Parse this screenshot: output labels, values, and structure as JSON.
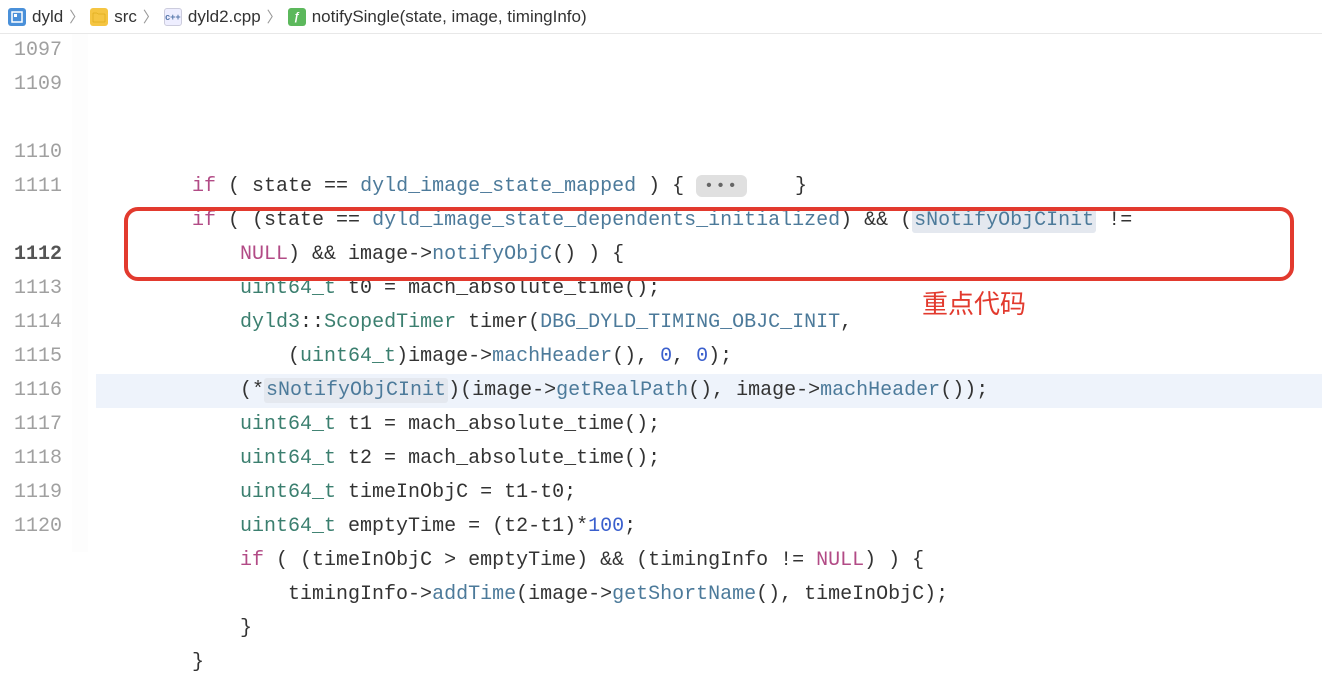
{
  "breadcrumb": {
    "project": "dyld",
    "folder": "src",
    "file": "dyld2.cpp",
    "func": "notifySingle(state, image, timingInfo)"
  },
  "annotation": "重点代码",
  "fold_marker": "•••",
  "lines": [
    {
      "no": "1097",
      "tokens": [
        {
          "t": "        ",
          "c": "op"
        },
        {
          "t": "if",
          "c": "kw"
        },
        {
          "t": " ( state == ",
          "c": "op"
        },
        {
          "t": "dyld_image_state_mapped",
          "c": "fn"
        },
        {
          "t": " ) { ",
          "c": "op"
        },
        {
          "t": "FOLD",
          "c": "fold"
        },
        {
          "t": "    }",
          "c": "op"
        }
      ]
    },
    {
      "no": "1109",
      "tokens": [
        {
          "t": "        ",
          "c": "op"
        },
        {
          "t": "if",
          "c": "kw"
        },
        {
          "t": " ( (state == ",
          "c": "op"
        },
        {
          "t": "dyld_image_state_dependents_initialized",
          "c": "fn"
        },
        {
          "t": ") && (",
          "c": "op"
        },
        {
          "t": "sNotifyObjCInit",
          "c": "hlvar"
        },
        {
          "t": " !=",
          "c": "op"
        }
      ]
    },
    {
      "no": "",
      "tokens": [
        {
          "t": "            ",
          "c": "op"
        },
        {
          "t": "NULL",
          "c": "kw"
        },
        {
          "t": ") && image->",
          "c": "op"
        },
        {
          "t": "notifyObjC",
          "c": "fn"
        },
        {
          "t": "() ) {",
          "c": "op"
        }
      ]
    },
    {
      "no": "1110",
      "tokens": [
        {
          "t": "            ",
          "c": "op"
        },
        {
          "t": "uint64_t",
          "c": "typ"
        },
        {
          "t": " t0 = ",
          "c": "op"
        },
        {
          "t": "mach_absolute_time",
          "c": "id"
        },
        {
          "t": "();",
          "c": "op"
        }
      ]
    },
    {
      "no": "1111",
      "tokens": [
        {
          "t": "            ",
          "c": "op"
        },
        {
          "t": "dyld3",
          "c": "typ"
        },
        {
          "t": "::",
          "c": "op"
        },
        {
          "t": "ScopedTimer",
          "c": "typ"
        },
        {
          "t": " timer(",
          "c": "op"
        },
        {
          "t": "DBG_DYLD_TIMING_OBJC_INIT",
          "c": "fn"
        },
        {
          "t": ",",
          "c": "op"
        }
      ]
    },
    {
      "no": "",
      "tokens": [
        {
          "t": "                (",
          "c": "op"
        },
        {
          "t": "uint64_t",
          "c": "typ"
        },
        {
          "t": ")image->",
          "c": "op"
        },
        {
          "t": "machHeader",
          "c": "fn"
        },
        {
          "t": "(), ",
          "c": "op"
        },
        {
          "t": "0",
          "c": "num"
        },
        {
          "t": ", ",
          "c": "op"
        },
        {
          "t": "0",
          "c": "num"
        },
        {
          "t": ");",
          "c": "op"
        }
      ]
    },
    {
      "no": "1112",
      "hl": true,
      "tokens": [
        {
          "t": "            (*",
          "c": "op"
        },
        {
          "t": "sNotifyObjCInit",
          "c": "hlvar"
        },
        {
          "t": ")(image->",
          "c": "op"
        },
        {
          "t": "getRealPath",
          "c": "fn"
        },
        {
          "t": "(), image->",
          "c": "op"
        },
        {
          "t": "machHeader",
          "c": "fn"
        },
        {
          "t": "());",
          "c": "op"
        }
      ]
    },
    {
      "no": "1113",
      "tokens": [
        {
          "t": "            ",
          "c": "op"
        },
        {
          "t": "uint64_t",
          "c": "typ"
        },
        {
          "t": " t1 = ",
          "c": "op"
        },
        {
          "t": "mach_absolute_time",
          "c": "id"
        },
        {
          "t": "();",
          "c": "op"
        }
      ]
    },
    {
      "no": "1114",
      "tokens": [
        {
          "t": "            ",
          "c": "op"
        },
        {
          "t": "uint64_t",
          "c": "typ"
        },
        {
          "t": " t2 = ",
          "c": "op"
        },
        {
          "t": "mach_absolute_time",
          "c": "id"
        },
        {
          "t": "();",
          "c": "op"
        }
      ]
    },
    {
      "no": "1115",
      "tokens": [
        {
          "t": "            ",
          "c": "op"
        },
        {
          "t": "uint64_t",
          "c": "typ"
        },
        {
          "t": " timeInObjC = t1-t0;",
          "c": "op"
        }
      ]
    },
    {
      "no": "1116",
      "tokens": [
        {
          "t": "            ",
          "c": "op"
        },
        {
          "t": "uint64_t",
          "c": "typ"
        },
        {
          "t": " emptyTime = (t2-t1)*",
          "c": "op"
        },
        {
          "t": "100",
          "c": "num"
        },
        {
          "t": ";",
          "c": "op"
        }
      ]
    },
    {
      "no": "1117",
      "tokens": [
        {
          "t": "            ",
          "c": "op"
        },
        {
          "t": "if",
          "c": "kw"
        },
        {
          "t": " ( (timeInObjC > emptyTime) && (timingInfo != ",
          "c": "op"
        },
        {
          "t": "NULL",
          "c": "kw"
        },
        {
          "t": ") ) {",
          "c": "op"
        }
      ]
    },
    {
      "no": "1118",
      "tokens": [
        {
          "t": "                timingInfo->",
          "c": "op"
        },
        {
          "t": "addTime",
          "c": "fn"
        },
        {
          "t": "(image->",
          "c": "op"
        },
        {
          "t": "getShortName",
          "c": "fn"
        },
        {
          "t": "(), timeInObjC);",
          "c": "op"
        }
      ]
    },
    {
      "no": "1119",
      "tokens": [
        {
          "t": "            }",
          "c": "op"
        }
      ]
    },
    {
      "no": "1120",
      "tokens": [
        {
          "t": "        }",
          "c": "op"
        }
      ]
    }
  ]
}
